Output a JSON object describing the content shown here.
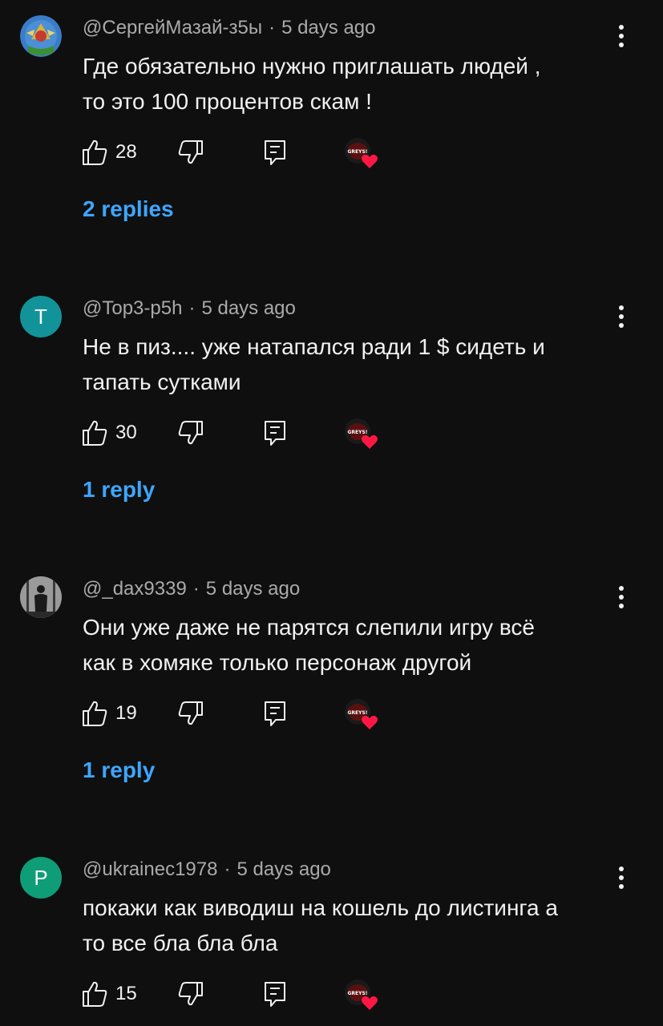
{
  "comments": [
    {
      "author": "@СергейМазай-з5ы",
      "time": "5 days ago",
      "text_lines": [
        "Где обязательно нужно приглашать людей ,",
        "то это 100 процентов скам !"
      ],
      "likes": "28",
      "replies_label": "2 replies",
      "avatar_letter": "",
      "avatar_color": "#2b6fb8"
    },
    {
      "author": "@Top3-p5h",
      "time": "5 days ago",
      "text_lines": [
        "Не в пиз.... уже натапался ради 1 $ сидеть и",
        "тапать сутками"
      ],
      "likes": "30",
      "replies_label": "1 reply",
      "avatar_letter": "T",
      "avatar_color": "#12939a"
    },
    {
      "author": "@_dax9339",
      "time": "5 days ago",
      "text_lines": [
        "Они уже даже не парятся слепили игру всё",
        "как в хомяке только персонаж другой"
      ],
      "likes": "19",
      "replies_label": "1 reply",
      "avatar_letter": "",
      "avatar_color": "#6a6a6a"
    },
    {
      "author": "@ukrainec1978",
      "time": "5 days ago",
      "text_lines": [
        "покажи как  виводиш на кошель до листинга а",
        "то все бла бла бла"
      ],
      "likes": "15",
      "replies_label": "",
      "avatar_letter": "P",
      "avatar_color": "#0f9d78"
    }
  ],
  "creator_badge_text": "GREYS!",
  "colors": {
    "background": "#0f0f0f",
    "link": "#3ea6ff",
    "heart": "#ff1744",
    "meta": "#aaaaaa"
  },
  "icons": [
    "thumb-up-icon",
    "thumb-down-icon",
    "reply-icon",
    "creator-heart-icon",
    "more-vertical-icon"
  ]
}
